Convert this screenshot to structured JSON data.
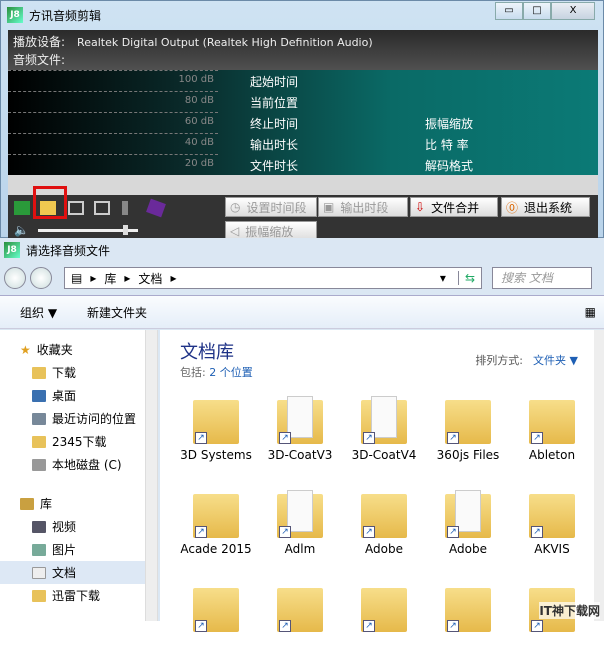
{
  "app": {
    "title": "方讯音频剪辑",
    "logo": "J8",
    "device_label": "播放设备:",
    "device_value": "Realtek Digital Output (Realtek High Definition Audio)",
    "file_label": "音频文件:",
    "db_levels": [
      "100 dB",
      "80 dB",
      "60 dB",
      "40 dB",
      "20 dB"
    ],
    "labels_left": [
      "起始时间",
      "当前位置",
      "终止时间",
      "输出时长",
      "文件时长"
    ],
    "labels_right": [
      "振幅缩放",
      "比 特 率",
      "解码格式"
    ],
    "buttons": {
      "set_time": "设置时间段",
      "output": "输出时段",
      "merge": "文件合并",
      "exit": "退出系统",
      "amplitude": "振幅缩放"
    },
    "window_buttons": {
      "minimize": "▭",
      "maximize": "□",
      "close": "X"
    },
    "volume": 0.85
  },
  "dialog": {
    "title": "请选择音频文件",
    "breadcrumb": [
      "库",
      "文档"
    ],
    "search_placeholder": "搜索 文档",
    "organize": "组织 ▼",
    "new_folder": "新建文件夹",
    "nav": {
      "favorites": "收藏夹",
      "fav_items": [
        "下载",
        "桌面",
        "最近访问的位置",
        "2345下载",
        "本地磁盘 (C)"
      ],
      "libraries": "库",
      "lib_items": [
        "视频",
        "图片",
        "文档",
        "迅雷下载"
      ]
    },
    "library_title": "文档库",
    "includes_label": "包括:",
    "includes_value": "2 个位置",
    "sort_label": "排列方式:",
    "sort_value": "文件夹 ▼",
    "folders": [
      "3D Systems",
      "3D-CoatV3",
      "3D-CoatV4",
      "360js Files",
      "Ableton",
      "Acade 2015",
      "Adlm",
      "Adobe",
      "Adobe",
      "AKVIS",
      "",
      "",
      "",
      "",
      ""
    ]
  },
  "watermark": "IT神下载网"
}
